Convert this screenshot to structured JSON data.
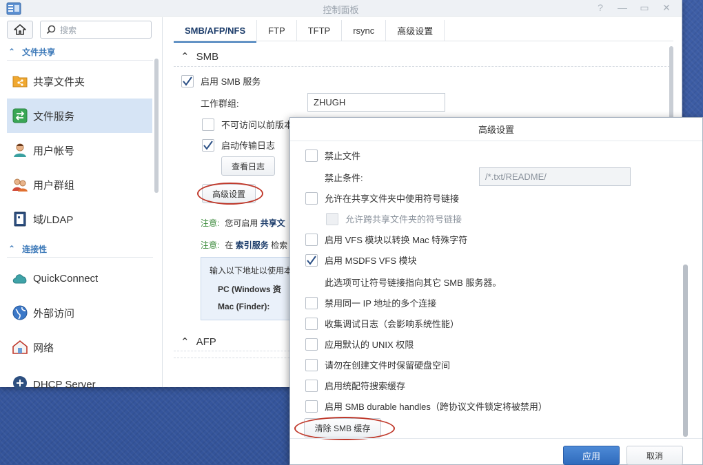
{
  "window": {
    "title": "控制面板",
    "controls": [
      "?",
      "—",
      "▭",
      "✕"
    ]
  },
  "sidebar": {
    "search_placeholder": "搜索",
    "sections": [
      {
        "label": "文件共享",
        "icon": "chevron-up-icon"
      },
      {
        "label": "连接性",
        "icon": "chevron-up-icon"
      }
    ],
    "items": [
      {
        "label": "共享文件夹",
        "icon": "shared-folder-icon"
      },
      {
        "label": "文件服务",
        "icon": "file-services-icon",
        "active": true
      },
      {
        "label": "用户帐号",
        "icon": "user-icon"
      },
      {
        "label": "用户群组",
        "icon": "group-icon"
      },
      {
        "label": "域/LDAP",
        "icon": "domain-icon"
      },
      {
        "label": "QuickConnect",
        "icon": "cloud-icon"
      },
      {
        "label": "外部访问",
        "icon": "globe-icon"
      },
      {
        "label": "网络",
        "icon": "network-icon"
      },
      {
        "label": "DHCP Server",
        "icon": "dhcp-icon"
      }
    ]
  },
  "tabs": [
    "SMB/AFP/NFS",
    "FTP",
    "TFTP",
    "rsync",
    "高级设置"
  ],
  "smb": {
    "heading": "SMB",
    "enable_label": "启用 SMB 服务",
    "workgroup_label": "工作群组:",
    "workgroup_value": "ZHUGH",
    "hide_label": "不可访问以前版本",
    "log_label": "启动传输日志",
    "view_log_button": "查看日志",
    "advanced_button": "高级设置",
    "note1_label": "注意:",
    "note1_text": "您可启用",
    "note1_bold": "共享文",
    "note2_label": "注意:",
    "note2_text": "在",
    "note2_bold": "索引服务",
    "note2_tail": "检索",
    "info_line1": "输入以下地址以使用本",
    "info_pc": "PC (Windows 资",
    "info_mac": "Mac (Finder):"
  },
  "afp": {
    "heading": "AFP"
  },
  "dialog": {
    "title": "高级设置",
    "veto_label": "禁止文件",
    "veto_cond_label": "禁止条件:",
    "veto_cond_value": "/*.txt/README/",
    "symlink_label": "允许在共享文件夹中使用符号链接",
    "symlink_cross_label": "允许跨共享文件夹的符号链接",
    "vfs_mac_label": "启用 VFS 模块以转换 Mac 特殊字符",
    "msdfs_label": "启用 MSDFS VFS 模块",
    "msdfs_desc": "此选项可让符号链接指向其它 SMB 服务器。",
    "multi_ip_label": "禁用同一 IP 地址的多个连接",
    "debug_log_label": "收集调试日志（会影响系统性能）",
    "unix_perm_label": "应用默认的 UNIX 权限",
    "reserve_label": "请勿在创建文件时保留硬盘空间",
    "wildcard_label": "启用统配符搜索缓存",
    "durable_label": "启用 SMB durable handles（跨协议文件锁定将被禁用）",
    "clear_cache_button": "清除 SMB 缓存",
    "apply_button": "应用",
    "cancel_button": "取消"
  }
}
